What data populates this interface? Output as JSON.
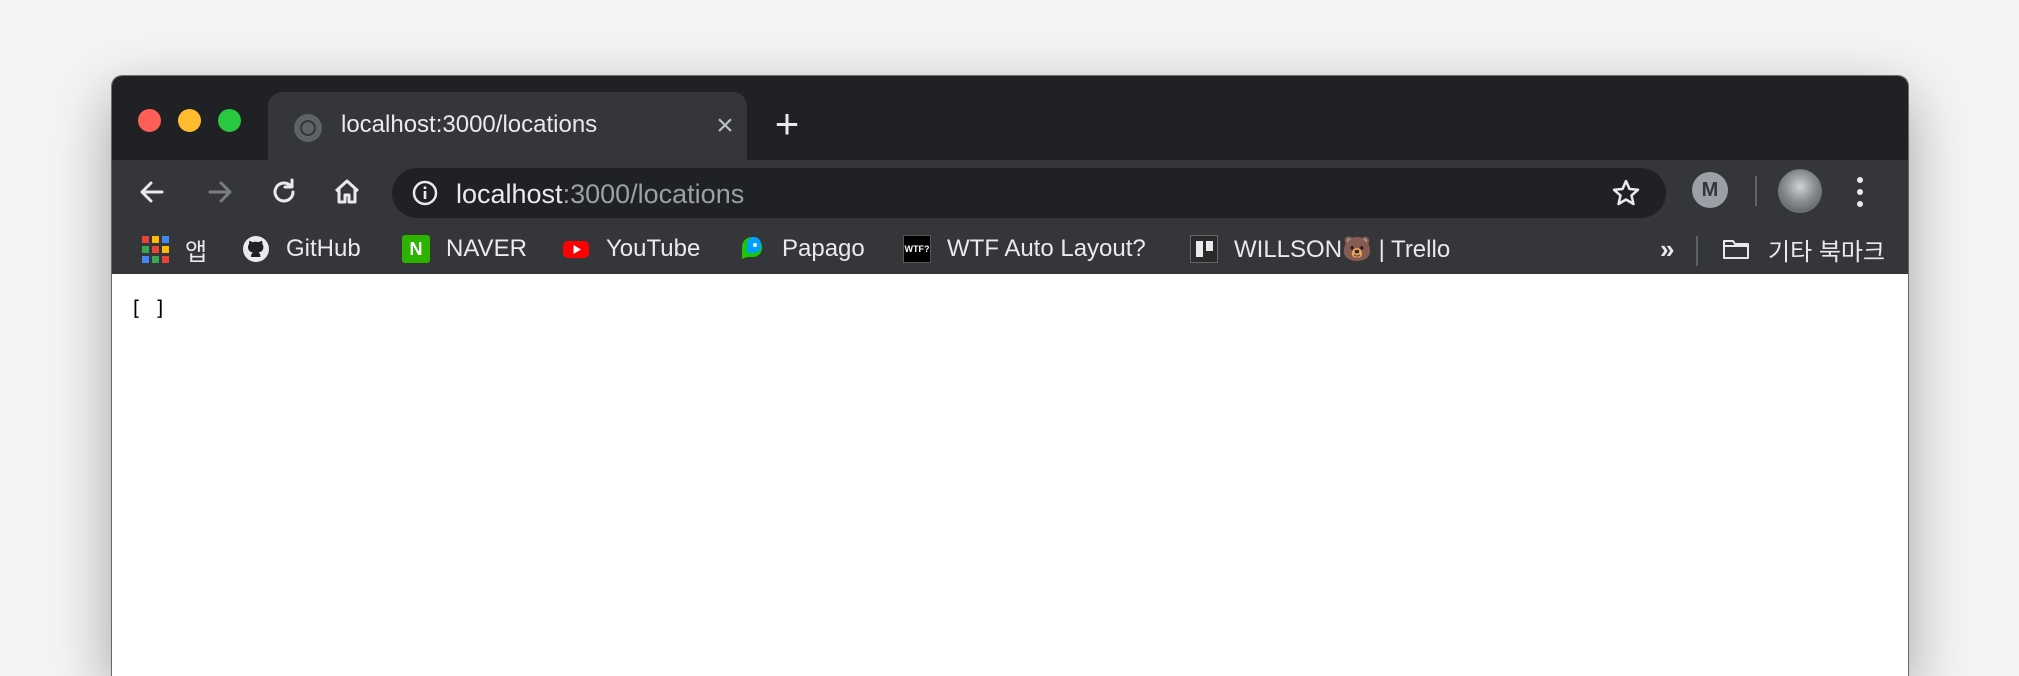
{
  "tab": {
    "title": "localhost:3000/locations",
    "close_label": "×",
    "new_tab_label": "+"
  },
  "omnibox": {
    "host": "localhost",
    "path": ":3000/locations"
  },
  "bookmarks": {
    "items": [
      {
        "label": "앱",
        "icon": "apps-grid-icon"
      },
      {
        "label": "GitHub",
        "icon": "github-icon"
      },
      {
        "label": "NAVER",
        "icon": "naver-icon"
      },
      {
        "label": "YouTube",
        "icon": "youtube-icon"
      },
      {
        "label": "Papago",
        "icon": "papago-icon"
      },
      {
        "label": "WTF Auto Layout?",
        "icon": "wtf-icon",
        "icon_text": "WTF?"
      },
      {
        "label": "WILLSON🐻 | Trello",
        "icon": "trello-icon"
      }
    ],
    "overflow_label": "»",
    "other_label": "기타 북마크"
  },
  "extension": {
    "label": "M"
  },
  "page": {
    "body_text": "[ ]"
  },
  "colors": {
    "titlebar": "#202124",
    "toolbar": "#35363a",
    "text": "#e8eaed",
    "url_path": "#9aa0a6",
    "close": "#ff5f57",
    "minimize": "#febc2e",
    "maximize": "#28c840"
  }
}
